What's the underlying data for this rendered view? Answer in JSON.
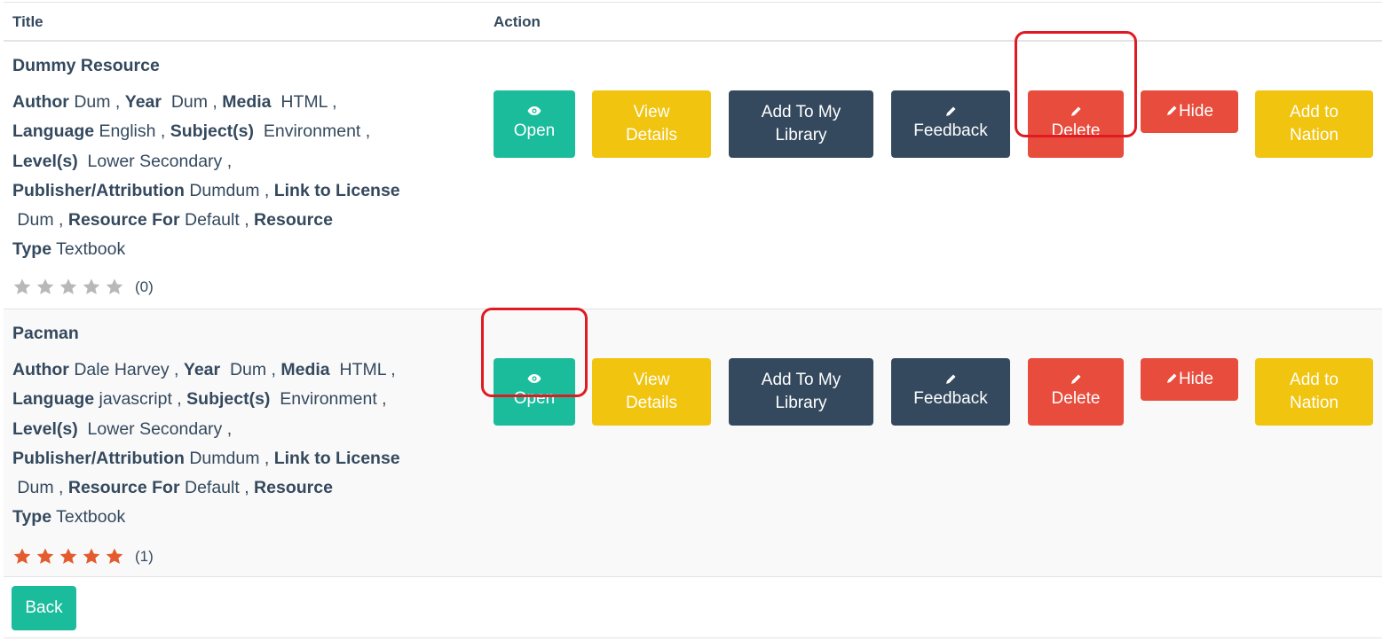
{
  "table": {
    "headers": {
      "title": "Title",
      "action": "Action"
    }
  },
  "buttons": {
    "open": "Open",
    "view": [
      "View",
      "Details"
    ],
    "add_library": [
      "Add To My",
      "Library"
    ],
    "feedback": "Feedback",
    "delete": "Delete",
    "hide": "Hide",
    "add_nation": [
      "Add to",
      "Nation"
    ]
  },
  "rows": [
    {
      "title": "Dummy Resource",
      "author": "Dum",
      "year": "Dum",
      "media": "HTML",
      "language": "English",
      "subjects": "Environment",
      "levels": "Lower Secondary",
      "publisher": "Dumdum",
      "link_to_license": "Dum",
      "resource_for": "Default",
      "resource_type": "Textbook",
      "rating_count": "(0)",
      "rating": 0
    },
    {
      "title": "Pacman",
      "author": "Dale Harvey",
      "year": "Dum",
      "media": "HTML",
      "language": "javascript",
      "subjects": "Environment",
      "levels": "Lower Secondary",
      "publisher": "Dumdum",
      "link_to_license": "Dum",
      "resource_for": "Default",
      "resource_type": "Textbook",
      "rating_count": "(1)",
      "rating": 5
    }
  ],
  "labels": {
    "author": "Author",
    "year": "Year",
    "media": "Media",
    "language": "Language",
    "subjects": "Subject(s)",
    "levels": "Level(s)",
    "publisher": "Publisher/Attribution",
    "link_to_license": "Link to License",
    "resource_for": "Resource For",
    "resource": "Resource",
    "type": "Type"
  },
  "footer": {
    "back": "Back"
  },
  "colors": {
    "teal": "#1abc9c",
    "yellow": "#f1c40f",
    "navy": "#34495e",
    "red": "#e74c3c",
    "highlight": "#e01a22",
    "star_filled": "#e35b2e",
    "star_empty": "#b8b8b8"
  },
  "icons": {
    "open": "eye-icon",
    "feedback": "pencil-icon",
    "delete": "pencil-icon",
    "hide": "pencil-icon",
    "rating": "star-icon"
  }
}
